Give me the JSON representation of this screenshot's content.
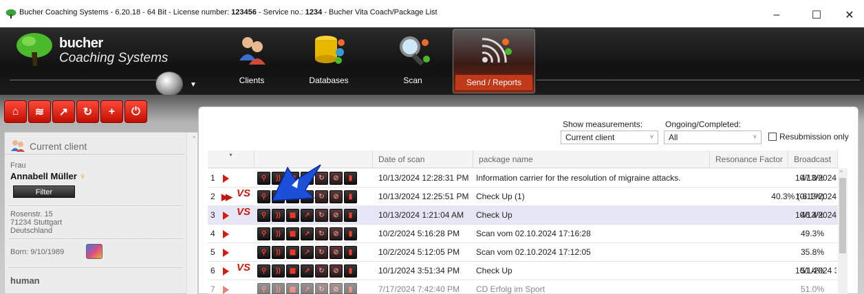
{
  "window": {
    "title_prefix": "Bucher Coaching Systems - 6.20.18 - 64 Bit - License number: ",
    "license_number": "123456",
    "title_mid": " - Service no.: ",
    "service_number": "1234",
    "title_suffix": " - Bucher Vita Coach/Package List",
    "minimize": "–",
    "maximize": "☐",
    "close": "✕"
  },
  "logo": {
    "word1": "bucher",
    "word2": "Coaching Systems"
  },
  "ribbon": {
    "clients": "Clients",
    "databases": "Databases",
    "scan": "Scan",
    "send_reports": "Send / Reports"
  },
  "toolbar": {
    "icons": [
      "home-icon",
      "scan-waves-icon",
      "export-icon",
      "history-icon",
      "add-icon",
      "stop-icon"
    ]
  },
  "left_panel": {
    "header": "Current client",
    "salutation": "Frau",
    "name": "Annabell Müller",
    "gender_symbol": "♀",
    "filter_button": "Filter",
    "street": "Rosenstr. 15",
    "city": "71234 Stuttgart",
    "country": "Deutschland",
    "born": "Born: 9/10/1989",
    "category": "human"
  },
  "filters": {
    "show_measurements_label": "Show measurements:",
    "show_measurements_value": "Current client",
    "ongoing_label": "Ongoing/Completed:",
    "ongoing_value": "All",
    "resubmission_label": "Resubmission only"
  },
  "grid": {
    "columns": {
      "date": "Date of scan",
      "package": "package name",
      "resonance": "Resonance Factor",
      "broadcast": "Broadcast"
    },
    "rows": [
      {
        "num": "1",
        "vs": "",
        "ff": false,
        "date": "10/13/2024 12:28:31 PM",
        "package": "Information carrier for the resolution of migraine attacks.",
        "resonance": "47.0%",
        "broadcast": "10/13/2024"
      },
      {
        "num": "2",
        "vs": "VS",
        "ff": true,
        "date": "10/13/2024 12:25:51 PM",
        "package": "Check Up (1)",
        "resonance": "40.3% (-6.1%)",
        "broadcast": "10/13/2024"
      },
      {
        "num": "3",
        "vs": "VS",
        "ff": false,
        "date": "10/13/2024 1:21:04 AM",
        "package": "Check Up",
        "resonance": "46.4%",
        "broadcast": "10/13/2024"
      },
      {
        "num": "4",
        "vs": "",
        "ff": false,
        "date": "10/2/2024 5:16:28 PM",
        "package": "Scan vom 02.10.2024 17:16:28",
        "resonance": "49.3%",
        "broadcast": ""
      },
      {
        "num": "5",
        "vs": "",
        "ff": false,
        "date": "10/2/2024 5:12:05 PM",
        "package": "Scan vom 02.10.2024 17:12:05",
        "resonance": "35.8%",
        "broadcast": ""
      },
      {
        "num": "6",
        "vs": "VS",
        "ff": false,
        "date": "10/1/2024 3:51:34 PM",
        "package": "Check Up",
        "resonance": "51.4%",
        "broadcast": "10/1/2024 3:"
      },
      {
        "num": "7",
        "vs": "",
        "ff": false,
        "date": "7/17/2024 7:42:40 PM",
        "package": "CD Erfolg im Sport",
        "resonance": "51.0%",
        "broadcast": ""
      }
    ]
  },
  "colors": {
    "accent_red": "#d01f10",
    "selection": "#e7e6f6",
    "ribbon_dark": "#111111"
  }
}
